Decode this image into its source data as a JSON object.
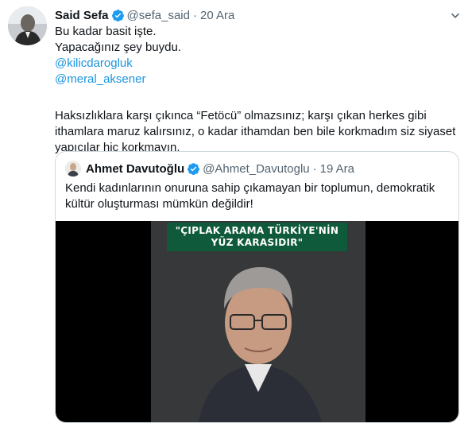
{
  "tweet": {
    "author_name": "Said Sefa",
    "author_handle": "@sefa_said",
    "separator": "·",
    "date": "20 Ara",
    "lines": [
      "Bu kadar basit işte.",
      "Yapacağınız şey buydu."
    ],
    "mentions": [
      "@kilicdarogluk",
      "@meral_aksener"
    ],
    "paragraph": [
      "Haksızlıklara karşı çıkınca “Fetöcü” olmazsınız; karşı çıkan herkes gibi",
      "ithamlara maruz kalırsınız, o kadar ithamdan ben bile korkmadım siz siyaset",
      "yapıcılar hiç korkmayın."
    ]
  },
  "quote": {
    "author_name": "Ahmet Davutoğlu",
    "author_handle": "@Ahmet_Davutoglu",
    "separator": "·",
    "date": "19 Ara",
    "lines": [
      "Kendi kadınlarının onuruna sahip çıkamayan bir toplumun, demokratik",
      "kültür oluşturması mümkün değildir!"
    ],
    "video_banner": [
      "\"ÇIPLAK ARAMA TÜRKİYE'NİN",
      "YÜZ KARASIDIR\""
    ]
  },
  "colors": {
    "link": "#1b95e0",
    "verified": "#1d9bf0",
    "secondary_text": "#536471",
    "banner_green": "#0f5a3a"
  },
  "icons": [
    "verified-badge-icon",
    "more-options-icon"
  ]
}
